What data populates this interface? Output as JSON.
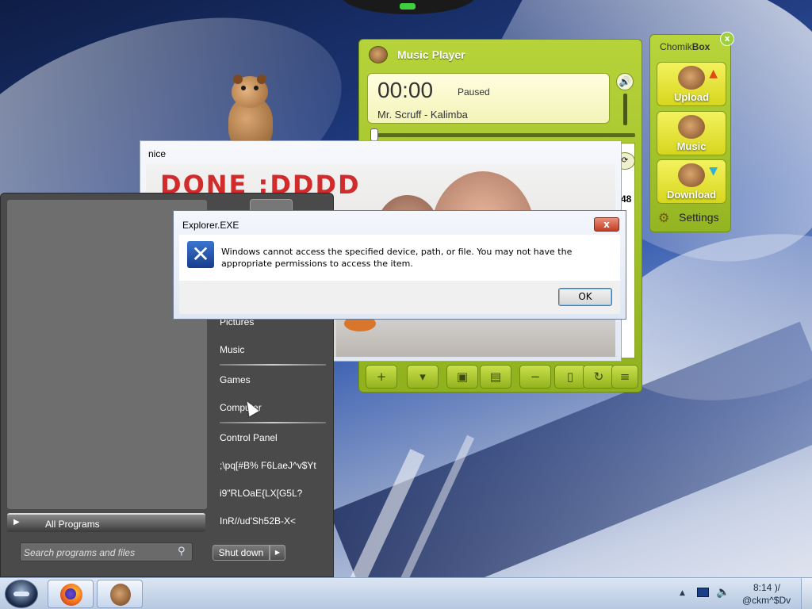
{
  "music_player": {
    "title": "Music Player",
    "time": "00:00",
    "status": "Paused",
    "track": "Mr. Scruff - Kalimba",
    "duration": ":48",
    "toolbar_icons": [
      "add-user-icon",
      "favorite-icon",
      "add-folder-icon",
      "add-folder-alt-icon",
      "remove-icon",
      "add-file-icon",
      "refresh-icon",
      "edit-list-icon"
    ]
  },
  "chomikbox": {
    "title_prefix": "Chomik",
    "title_suffix": "Box",
    "close_label": "x",
    "upload_label": "Upload",
    "music_label": "Music",
    "download_label": "Download",
    "settings_label": "Settings"
  },
  "nice_window": {
    "title": "nice",
    "banner_text": "DONE :DDDD"
  },
  "dialog": {
    "title": "Explorer.EXE",
    "close_label": "x",
    "message": "Windows cannot access the specified device, path, or file.  You may not have the appropriate permissions to access the item.",
    "ok_label": "OK"
  },
  "start_menu": {
    "right_items": [
      {
        "label": "Pictures"
      },
      {
        "label": "Music"
      },
      {
        "label": "Games"
      },
      {
        "label": "Computer"
      },
      {
        "label": "Control Panel"
      },
      {
        "label": ";\\pq[#B% F6LaeJ^v$Yt"
      },
      {
        "label": "i9\"RLOaE{LX[G5L?"
      },
      {
        "label": "InR//ud'Sh52B-X<"
      }
    ],
    "all_programs_label": "All Programs",
    "search_placeholder": "Search programs and files",
    "shutdown_label": "Shut down"
  },
  "taskbar": {
    "clock_time": "8:14 )/",
    "clock_date": "@ckm^$Dv"
  },
  "colors": {
    "widget_green": "#a6c52c",
    "dialog_close_red": "#c43d23",
    "banner_red": "#d22b2b"
  }
}
